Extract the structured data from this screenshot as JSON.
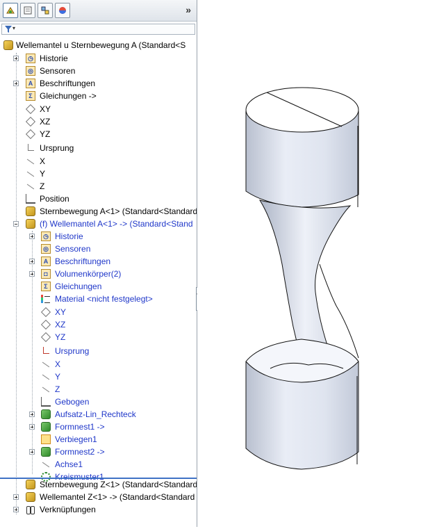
{
  "tabs": [
    {
      "name": "featuremanager-tab"
    },
    {
      "name": "propertymanager-tab"
    },
    {
      "name": "configurationmanager-tab"
    },
    {
      "name": "appearance-tab"
    }
  ],
  "tab_more": "»",
  "filter": {
    "caret": "▾"
  },
  "tree": {
    "root": "Wellemantel u Sternbewegung A  (Standard<S",
    "items": [
      {
        "label": "Historie"
      },
      {
        "label": "Sensoren"
      },
      {
        "label": "Beschriftungen"
      },
      {
        "label": "Gleichungen ->"
      },
      {
        "label": "XY"
      },
      {
        "label": "XZ"
      },
      {
        "label": "YZ"
      },
      {
        "label": "Ursprung"
      },
      {
        "label": "X"
      },
      {
        "label": "Y"
      },
      {
        "label": "Z"
      },
      {
        "label": "Position"
      },
      {
        "label": "Sternbewegung A<1> (Standard<Standard"
      },
      {
        "label": "(f) Wellemantel A<1> -> (Standard<Stand"
      },
      {
        "label": "Historie"
      },
      {
        "label": "Sensoren"
      },
      {
        "label": "Beschriftungen"
      },
      {
        "label": "Volumenkörper(2)"
      },
      {
        "label": "Gleichungen"
      },
      {
        "label": "Material <nicht festgelegt>"
      },
      {
        "label": "XY"
      },
      {
        "label": "XZ"
      },
      {
        "label": "YZ"
      },
      {
        "label": "Ursprung"
      },
      {
        "label": "X"
      },
      {
        "label": "Y"
      },
      {
        "label": "Z"
      },
      {
        "label": "Gebogen"
      },
      {
        "label": "Aufsatz-Lin_Rechteck"
      },
      {
        "label": "Formnest1 ->"
      },
      {
        "label": "Verbiegen1"
      },
      {
        "label": "Formnest2 ->"
      },
      {
        "label": "Achse1"
      },
      {
        "label": "Kreismuster1"
      },
      {
        "label": "Sternbewegung Z<1> (Standard<Standard"
      },
      {
        "label": "Wellemantel Z<1> -> (Standard<Standard"
      },
      {
        "label": "Verknüpfungen"
      }
    ]
  },
  "collapse_handle": "‹‹‹",
  "colors": {
    "assembly_blue": "#1f37c9",
    "selection_line": "#3f72c5",
    "part_body": "#dfe4ef"
  }
}
